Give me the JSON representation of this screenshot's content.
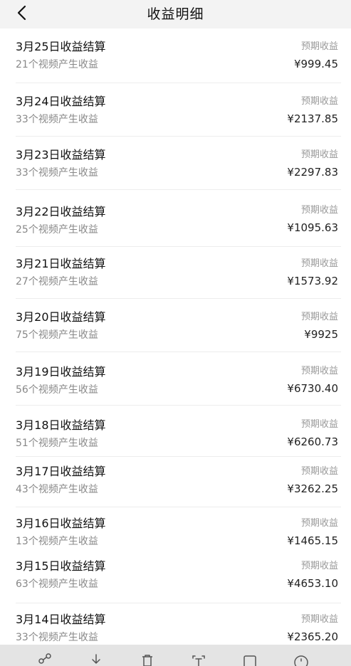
{
  "header": {
    "back_icon": "chevron-left-icon",
    "title": "收益明细"
  },
  "rows": [
    {
      "title": "3月25日收益结算",
      "sub": "21个视频产生收益",
      "label": "预期收益",
      "amount": "¥999.45"
    },
    {
      "title": "3月24日收益结算",
      "sub": "33个视频产生收益",
      "label": "预期收益",
      "amount": "¥2137.85"
    },
    {
      "title": "3月23日收益结算",
      "sub": "33个视频产生收益",
      "label": "预期收益",
      "amount": "¥2297.83"
    },
    {
      "title": "3月22日收益结算",
      "sub": "25个视频产生收益",
      "label": "预期收益",
      "amount": "¥1095.63"
    },
    {
      "title": "3月21日收益结算",
      "sub": "27个视频产生收益",
      "label": "预期收益",
      "amount": "¥1573.92"
    },
    {
      "title": "3月20日收益结算",
      "sub": "75个视频产生收益",
      "label": "预期收益",
      "amount": "¥9925"
    },
    {
      "title": "3月19日收益结算",
      "sub": "56个视频产生收益",
      "label": "预期收益",
      "amount": "¥6730.40"
    },
    {
      "title": "3月18日收益结算",
      "sub": "51个视频产生收益",
      "label": "预期收益",
      "amount": "¥6260.73"
    },
    {
      "title": "3月17日收益结算",
      "sub": "43个视频产生收益",
      "label": "预期收益",
      "amount": "¥3262.25"
    },
    {
      "title": "3月16日收益结算",
      "sub": "13个视频产生收益",
      "label": "预期收益",
      "amount": "¥1465.15"
    },
    {
      "title": "3月15日收益结算",
      "sub": "63个视频产生收益",
      "label": "预期收益",
      "amount": "¥4653.10"
    },
    {
      "title": "3月14日收益结算",
      "sub": "33个视频产生收益",
      "label": "预期收益",
      "amount": "¥2365.20"
    }
  ],
  "toolbar": {
    "icons": [
      "share-icon",
      "download-icon",
      "delete-icon",
      "text-extract-icon",
      "edit-icon",
      "info-icon"
    ]
  }
}
